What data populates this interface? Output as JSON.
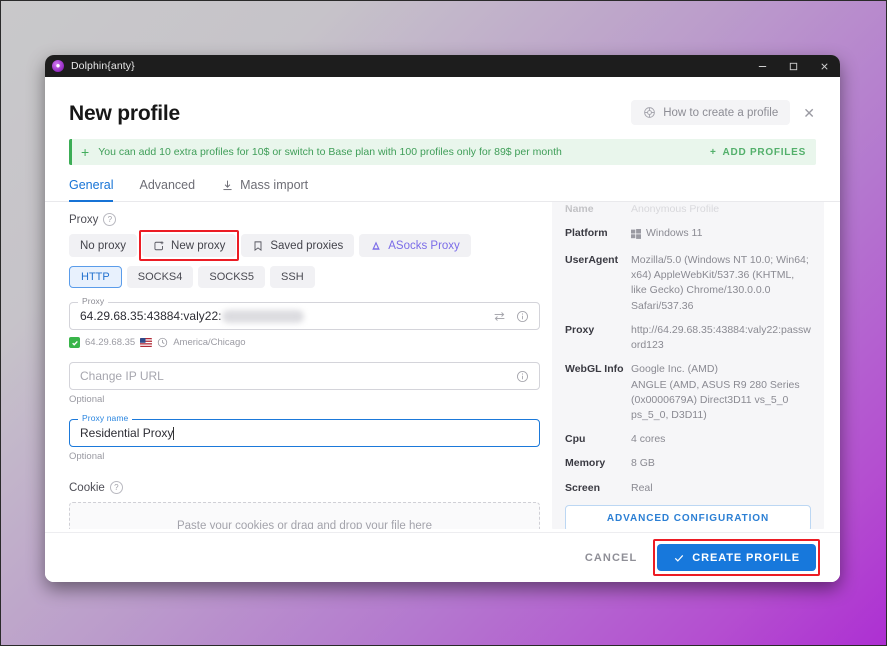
{
  "window": {
    "app_title": "Dolphin{anty}",
    "minimize_label": "Minimize",
    "maximize_label": "Maximize",
    "close_label": "Close"
  },
  "header": {
    "page_title": "New profile",
    "how_to_label": "How to create a profile",
    "close_label": "✕"
  },
  "banner": {
    "plus": "+",
    "text": "You can add 10 extra profiles for 10$ or switch to Base plan with 100 profiles only for 89$ per month",
    "add_profiles_label": "ADD PROFILES",
    "accent_color": "#3cad56"
  },
  "tabs": [
    {
      "label": "General",
      "active": true
    },
    {
      "label": "Advanced",
      "active": false
    },
    {
      "label": "Mass import",
      "active": false
    }
  ],
  "proxy_section": {
    "label": "Proxy",
    "modes": [
      {
        "label": "No proxy",
        "icon": "none",
        "highlighted": false
      },
      {
        "label": "New proxy",
        "icon": "new-proxy-icon",
        "highlighted": true
      },
      {
        "label": "Saved proxies",
        "icon": "bookmark-icon",
        "highlighted": false
      },
      {
        "label": "ASocks Proxy",
        "icon": "asocks-icon",
        "highlighted": false
      }
    ],
    "protocols": [
      {
        "label": "HTTP",
        "active": true
      },
      {
        "label": "SOCKS4",
        "active": false
      },
      {
        "label": "SOCKS5",
        "active": false
      },
      {
        "label": "SSH",
        "active": false
      }
    ],
    "proxy_field": {
      "legend": "Proxy",
      "value_visible": "64.29.68.35:43884:valy22:",
      "redacted": true
    },
    "status": {
      "ip": "64.29.68.35",
      "flag": "US",
      "timezone": "America/Chicago",
      "ok": true
    },
    "change_ip_field": {
      "placeholder": "Change IP URL",
      "hint": "Optional"
    },
    "proxy_name_field": {
      "legend": "Proxy name",
      "value": "Residential Proxy",
      "hint": "Optional",
      "focused": true
    }
  },
  "cookie_section": {
    "label": "Cookie",
    "dropzone_text": "Paste your cookies or drag and drop your file here"
  },
  "info_panel": {
    "rows": [
      {
        "key": "Name",
        "value": "Anonymous Profile",
        "faded": true
      },
      {
        "key": "Platform",
        "value": "Windows 11",
        "icon": "windows-icon"
      },
      {
        "key": "UserAgent",
        "value": "Mozilla/5.0 (Windows NT 10.0; Win64; x64) AppleWebKit/537.36 (KHTML, like Gecko) Chrome/130.0.0.0 Safari/537.36"
      },
      {
        "key": "Proxy",
        "value": "http://64.29.68.35:43884:valy22:password123"
      },
      {
        "key": "WebGL Info",
        "value": "Google Inc. (AMD)\nANGLE (AMD, ASUS R9 280 Series (0x0000679A) Direct3D11 vs_5_0 ps_5_0, D3D11)"
      },
      {
        "key": "Cpu",
        "value": "4 cores"
      },
      {
        "key": "Memory",
        "value": "8 GB"
      },
      {
        "key": "Screen",
        "value": "Real"
      }
    ],
    "advanced_button_label": "ADVANCED CONFIGURATION"
  },
  "footer": {
    "cancel_label": "CANCEL",
    "create_label": "CREATE PROFILE",
    "create_highlighted": true,
    "create_color": "#1778dc",
    "highlight_color": "#ec1c24"
  }
}
